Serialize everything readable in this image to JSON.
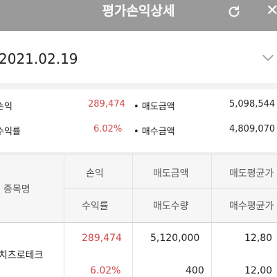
{
  "header": {
    "title": "평가손익상세",
    "refresh_icon": "refresh-icon",
    "close_icon": "close-icon",
    "close_glyph": "✕"
  },
  "date_selector": {
    "value": "2021.02.19",
    "icon": "chevron-down-icon"
  },
  "summary": {
    "rows": [
      {
        "label": "손익",
        "value": "289,474",
        "right_label": "• 매도금액",
        "right_value": "5,098,544"
      },
      {
        "label": "수익률",
        "value": "6.02%",
        "right_label": "• 매수금액",
        "right_value": "4,809,070"
      }
    ]
  },
  "table": {
    "headers": {
      "stock_name": "종목명",
      "row1": [
        "손익",
        "매도금액",
        "매도평균가"
      ],
      "row2": [
        "수익률",
        "매도수량",
        "매수평균가"
      ]
    },
    "rows": [
      {
        "name": "에이치엔에스하이텍케이트로테크",
        "name_visible": "치츠로테크",
        "profit": "289,474",
        "sell_amount": "5,120,000",
        "sell_avg_price": "12,80",
        "return_rate": "6.02%",
        "sell_qty": "400",
        "buy_avg_price": "12,00"
      }
    ]
  },
  "colors": {
    "header_bg": "#9a9a9a",
    "positive": "#d14a4a",
    "table_header_bg": "#f6f6f6"
  }
}
